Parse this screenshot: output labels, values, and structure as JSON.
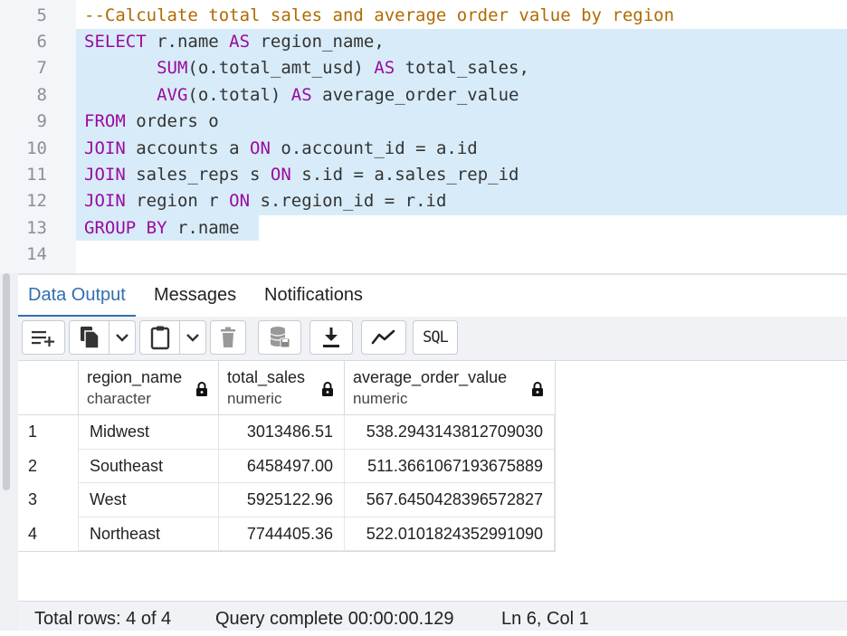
{
  "editor": {
    "lines": [
      {
        "n": "5",
        "parts": [
          {
            "t": "--Calculate total sales and average order value by region",
            "c": "cm"
          }
        ]
      },
      {
        "n": "6",
        "parts": [
          {
            "t": "SELECT",
            "c": "kw"
          },
          {
            "t": " r.name ",
            "c": ""
          },
          {
            "t": "AS",
            "c": "kw"
          },
          {
            "t": " region_name,",
            "c": ""
          }
        ]
      },
      {
        "n": "7",
        "parts": [
          {
            "t": "       ",
            "c": ""
          },
          {
            "t": "SUM",
            "c": "fn"
          },
          {
            "t": "(o.total_amt_usd) ",
            "c": ""
          },
          {
            "t": "AS",
            "c": "kw"
          },
          {
            "t": " total_sales,",
            "c": ""
          }
        ]
      },
      {
        "n": "8",
        "parts": [
          {
            "t": "       ",
            "c": ""
          },
          {
            "t": "AVG",
            "c": "fn"
          },
          {
            "t": "(o.total) ",
            "c": ""
          },
          {
            "t": "AS",
            "c": "kw"
          },
          {
            "t": " average_order_value",
            "c": ""
          }
        ]
      },
      {
        "n": "9",
        "parts": [
          {
            "t": "FROM",
            "c": "kw"
          },
          {
            "t": " orders o",
            "c": ""
          }
        ]
      },
      {
        "n": "10",
        "parts": [
          {
            "t": "JOIN",
            "c": "kw"
          },
          {
            "t": " accounts a ",
            "c": ""
          },
          {
            "t": "ON",
            "c": "kw"
          },
          {
            "t": " o.account_id = a.id",
            "c": ""
          }
        ]
      },
      {
        "n": "11",
        "parts": [
          {
            "t": "JOIN",
            "c": "kw"
          },
          {
            "t": " sales_reps s ",
            "c": ""
          },
          {
            "t": "ON",
            "c": "kw"
          },
          {
            "t": " s.id = a.sales_rep_id",
            "c": ""
          }
        ]
      },
      {
        "n": "12",
        "parts": [
          {
            "t": "JOIN",
            "c": "kw"
          },
          {
            "t": " region r ",
            "c": ""
          },
          {
            "t": "ON",
            "c": "kw"
          },
          {
            "t": " s.region_id = r.id",
            "c": ""
          }
        ]
      },
      {
        "n": "13",
        "parts": [
          {
            "t": "GROUP BY",
            "c": "kw"
          },
          {
            "t": " r.name",
            "c": ""
          }
        ]
      },
      {
        "n": "14",
        "parts": []
      }
    ]
  },
  "tabs": [
    {
      "label": "Data Output",
      "active": true
    },
    {
      "label": "Messages",
      "active": false
    },
    {
      "label": "Notifications",
      "active": false
    }
  ],
  "toolbar": {
    "icons": [
      "add-row-icon",
      "copy-icon",
      "chevron-down-icon",
      "paste-icon",
      "chevron-down-icon",
      "delete-icon",
      "save-data-icon",
      "download-icon",
      "graph-icon"
    ],
    "sql_label": "SQL"
  },
  "grid": {
    "columns": [
      {
        "name": "region_name",
        "type": "character"
      },
      {
        "name": "total_sales",
        "type": "numeric"
      },
      {
        "name": "average_order_value",
        "type": "numeric"
      }
    ],
    "rows": [
      {
        "n": "1",
        "cells": [
          "Midwest",
          "3013486.51",
          "538.2943143812709030"
        ]
      },
      {
        "n": "2",
        "cells": [
          "Southeast",
          "6458497.00",
          "511.3661067193675889"
        ]
      },
      {
        "n": "3",
        "cells": [
          "West",
          "5925122.96",
          "567.6450428396572827"
        ]
      },
      {
        "n": "4",
        "cells": [
          "Northeast",
          "7744405.36",
          "522.0101824352991090"
        ]
      }
    ]
  },
  "status": {
    "total_rows": "Total rows: 4 of 4",
    "query": "Query complete 00:00:00.129",
    "cursor": "Ln 6, Col 1"
  },
  "colors": {
    "keyword": "#9b0aa0",
    "comment": "#b06a00",
    "selection": "#d7ecf8",
    "accent": "#2f6fb1"
  }
}
